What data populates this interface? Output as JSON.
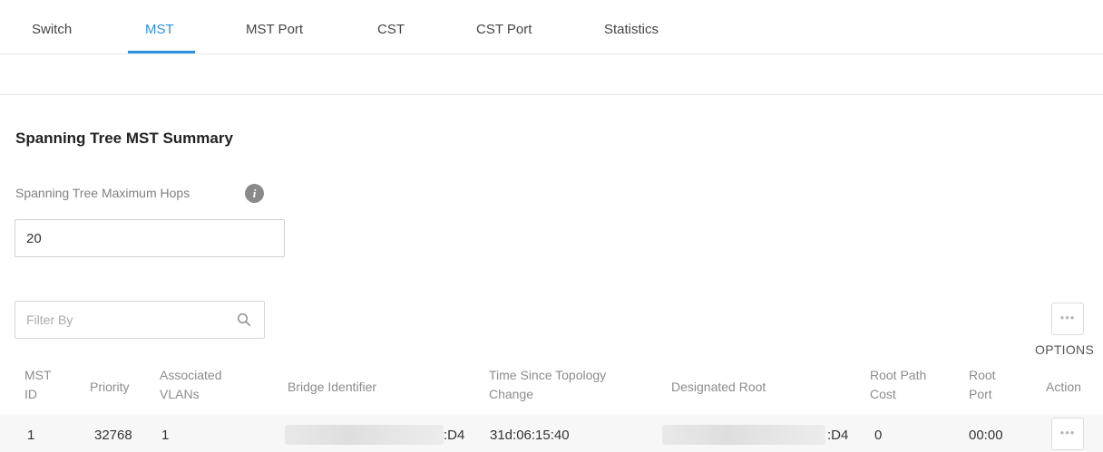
{
  "tabs": [
    {
      "label": "Switch",
      "active": false
    },
    {
      "label": "MST",
      "active": true
    },
    {
      "label": "MST Port",
      "active": false
    },
    {
      "label": "CST",
      "active": false
    },
    {
      "label": "CST Port",
      "active": false
    },
    {
      "label": "Statistics",
      "active": false
    }
  ],
  "summary": {
    "title": "Spanning Tree MST Summary",
    "max_hops_label": "Spanning Tree Maximum Hops",
    "max_hops_value": "20",
    "info_icon": "i"
  },
  "filter": {
    "placeholder": "Filter By"
  },
  "options": {
    "button_text": "•••",
    "label": "OPTIONS"
  },
  "table": {
    "columns": {
      "mst_id": [
        "MST",
        "ID"
      ],
      "priority": "Priority",
      "vlans": [
        "Associated",
        "VLANs"
      ],
      "bridge_id": "Bridge Identifier",
      "topology_change": [
        "Time Since Topology",
        "Change"
      ],
      "designated_root": "Designated Root",
      "root_path_cost": [
        "Root Path",
        "Cost"
      ],
      "root_port": [
        "Root",
        "Port"
      ],
      "action": "Action"
    },
    "rows": [
      {
        "mst_id": "1",
        "priority": "32768",
        "vlans": "1",
        "bridge_id_visible": ":D4",
        "topology_change": "31d:06:15:40",
        "designated_root_visible": ":D4",
        "root_path_cost": "0",
        "root_port": "00:00",
        "action_text": "•••"
      }
    ]
  },
  "colors": {
    "accent": "#2f8fe0",
    "header_text": "#8c8c8c",
    "row_background": "#f7f7f7"
  }
}
